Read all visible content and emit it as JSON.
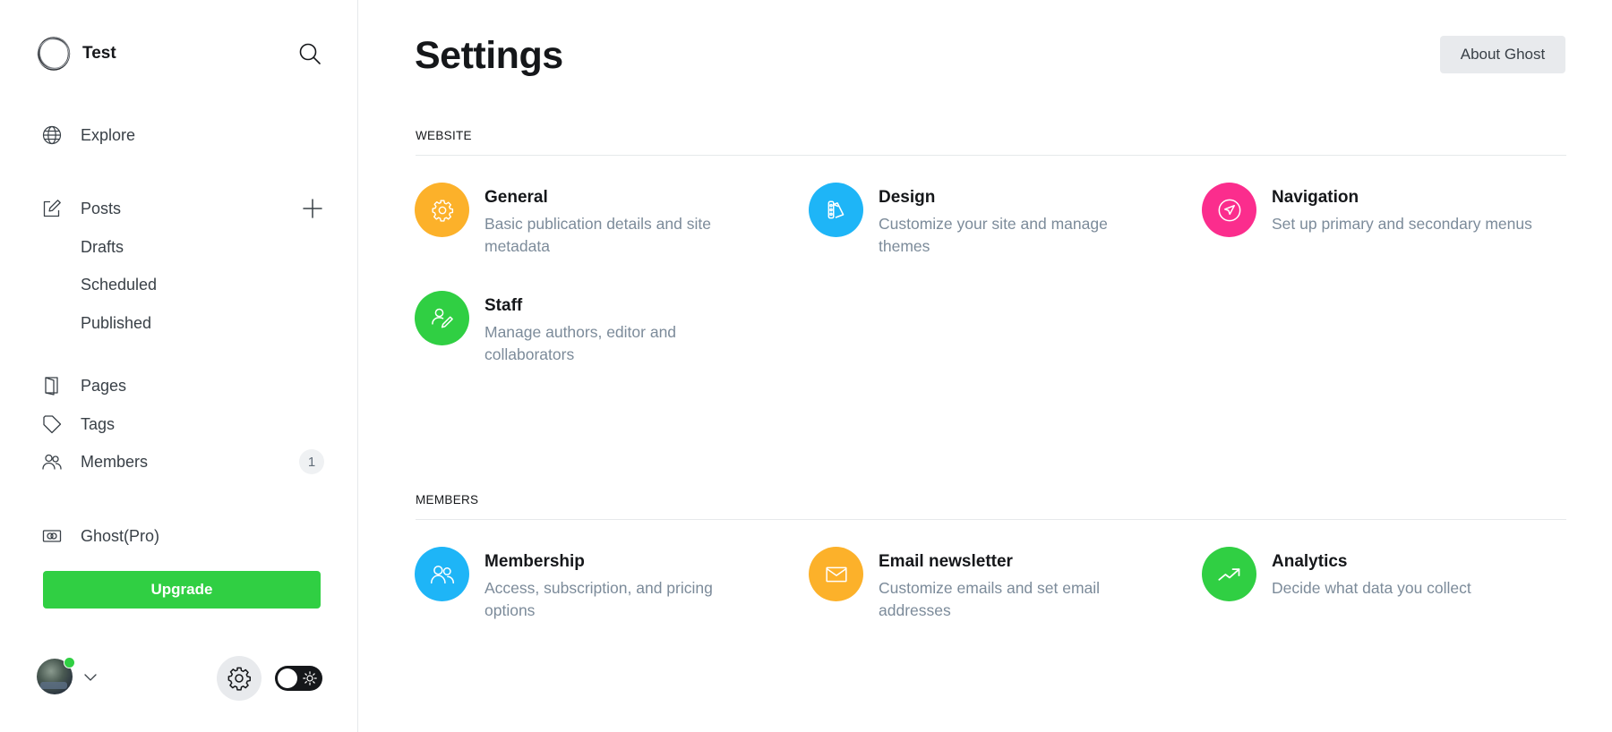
{
  "sidebar": {
    "brand": {
      "name": "Test",
      "logo_icon": "ghost-ring-logo"
    },
    "search_icon": "search-icon",
    "nav": {
      "explore": {
        "label": "Explore",
        "icon": "globe-icon"
      },
      "posts": {
        "label": "Posts",
        "icon": "pencil-square-icon",
        "add_icon": "plus-icon"
      },
      "posts_sub": [
        {
          "label": "Drafts"
        },
        {
          "label": "Scheduled"
        },
        {
          "label": "Published"
        }
      ],
      "pages": {
        "label": "Pages",
        "icon": "pages-icon"
      },
      "tags": {
        "label": "Tags",
        "icon": "tag-icon"
      },
      "members": {
        "label": "Members",
        "icon": "members-icon",
        "count": "1"
      },
      "ghost_pro": {
        "label": "Ghost(Pro)",
        "icon": "ghost-pro-icon"
      }
    },
    "upgrade_label": "Upgrade",
    "footer": {
      "avatar_status": "online",
      "settings_icon": "gear-icon",
      "theme_toggle": {
        "state": "light",
        "icon": "sun-icon"
      }
    },
    "colors": {
      "accent_green": "#30cf43"
    }
  },
  "main": {
    "title": "Settings",
    "about_button": "About Ghost",
    "sections": [
      {
        "header": "WEBSITE",
        "items": [
          {
            "title": "General",
            "description": "Basic publication details and site metadata",
            "icon": "gear-icon",
            "color": "#fcb12a"
          },
          {
            "title": "Design",
            "description": "Customize your site and manage themes",
            "icon": "palette-swatch-icon",
            "color": "#1eb5f7"
          },
          {
            "title": "Navigation",
            "description": "Set up primary and secondary menus",
            "icon": "navigation-arrow-icon",
            "color": "#fb2d8d"
          },
          {
            "title": "Staff",
            "description": "Manage authors, editor and collaborators",
            "icon": "user-edit-icon",
            "color": "#30cf43"
          }
        ]
      },
      {
        "header": "MEMBERS",
        "items": [
          {
            "title": "Membership",
            "description": "Access, subscription, and pricing options",
            "icon": "members-icon",
            "color": "#1eb5f7"
          },
          {
            "title": "Email newsletter",
            "description": "Customize emails and set email addresses",
            "icon": "envelope-icon",
            "color": "#fcb12a"
          },
          {
            "title": "Analytics",
            "description": "Decide what data you collect",
            "icon": "trend-up-icon",
            "color": "#30cf43"
          }
        ]
      }
    ]
  }
}
